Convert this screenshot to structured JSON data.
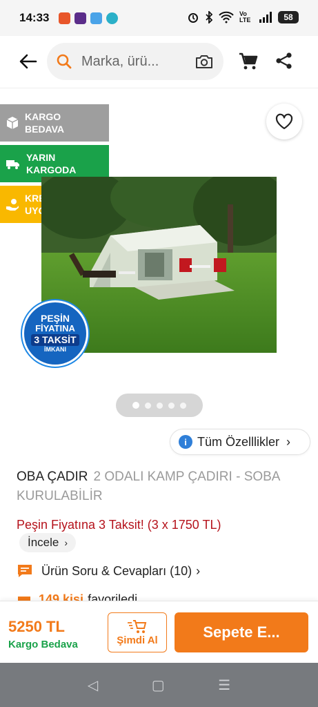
{
  "status_bar": {
    "time": "14:33",
    "battery": "58",
    "network": "Vo LTE"
  },
  "header": {
    "search_placeholder": "Marka, ürü..."
  },
  "badges": {
    "kargo": [
      "KARGO",
      "BEDAVA"
    ],
    "yarin": [
      "YARIN",
      "KARGODA"
    ],
    "kredi": [
      "KREDİYE",
      "UYGUN"
    ]
  },
  "promo_badge": {
    "line1": "PEŞİN",
    "line2": "FİYATINA",
    "line3": "3 TAKSİT",
    "line4": "İMKANI"
  },
  "gallery": {
    "image_count": 5,
    "active_index": 0
  },
  "specs_button": {
    "label": "Tüm Özelllikler"
  },
  "product": {
    "brand": "OBA ÇADIR",
    "name": "2 ODALI KAMP ÇADIRI - SOBA KURULABİLİR",
    "promo_text": "Peşin Fiyatına 3 Taksit! (3 x 1750 TL)",
    "incele_label": "İncele",
    "qa_label": "Ürün Soru & Cevapları (10)",
    "fav_count": "149 kişi",
    "fav_text": "favoriledi"
  },
  "bottom_bar": {
    "price": "5250 TL",
    "cargo": "Kargo Bedava",
    "buy_now": "Şimdi Al",
    "add_to_cart": "Sepete E..."
  },
  "colors": {
    "accent": "#f27a1a",
    "green": "#1aa24a",
    "yellow": "#f9b800",
    "promo_red": "#b5121b"
  }
}
